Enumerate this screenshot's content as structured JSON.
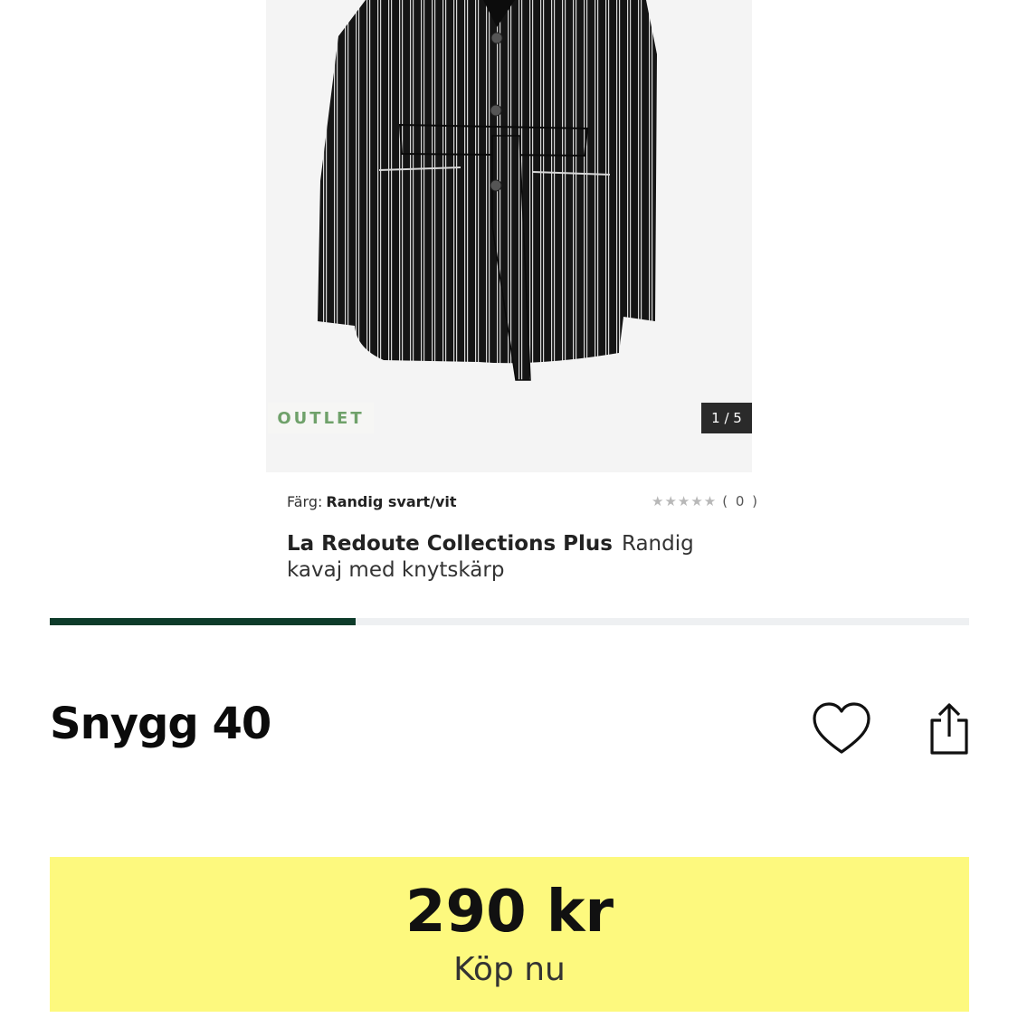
{
  "product": {
    "outlet_badge": "OUTLET",
    "image_counter": "1 / 5",
    "image_progress": 0.333,
    "color_label": "Färg:",
    "color_value": "Randig svart/vit",
    "rating_stars": "★★★★★",
    "rating_count": "( 0 )",
    "brand": "La Redoute Collections Plus",
    "name": "Randig kavaj med knytskärp"
  },
  "listing": {
    "title": "Snygg 40"
  },
  "buy": {
    "price": "290 kr",
    "label": "Köp nu"
  },
  "colors": {
    "accent_green": "#0d3b2a",
    "buy_yellow": "#fdf97e",
    "outlet_green": "#6fa16a"
  },
  "icons": {
    "favorite": "heart-icon",
    "share": "share-icon"
  }
}
